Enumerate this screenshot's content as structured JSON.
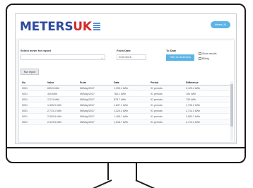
{
  "app": {
    "logo_part1": "METERS",
    "logo_part2": "UK",
    "header_button": "Meters UK"
  },
  "form": {
    "meter_label": "Select meter for report",
    "meter_value": "",
    "from_label": "From Date",
    "from_value": "01/01/2018",
    "to_label": "To Date",
    "to_value": "31/03/2018",
    "checkbox_1": "Show results",
    "checkbox_2": "Billing",
    "run_button": "Run report",
    "action_button": "Filter for all devices"
  },
  "table": {
    "headers": [
      "No.",
      "Value",
      "From",
      "Date",
      "Period",
      "Difference"
    ],
    "rows": [
      [
        "0001",
        "695.9 kWh",
        "06/May/2017",
        "1,393.1 kWh",
        "91 periods",
        "2,123.4 kWh"
      ],
      [
        "0001",
        "345 kWh",
        "06/May/2017",
        "765.1 kWh",
        "91 periods",
        "154 kWh"
      ],
      [
        "0001",
        "172.3 kWh",
        "06/May/2017",
        "678.7 kWh",
        "91 periods",
        "735 kWh"
      ],
      [
        "0001",
        "1,526.9 kWh",
        "06/May/2017",
        "1,837.1 kWh",
        "91 periods",
        "1,796.2 kWh"
      ],
      [
        "0001",
        "2,713.1 kWh",
        "06/May/2017",
        "1,224.2 kWh",
        "91 periods",
        "2,714.3 kWh"
      ],
      [
        "0001",
        "2,553.8 kWh",
        "06/May/2017",
        "1,165.1 kWh",
        "91 periods",
        "2,853.2 kWh"
      ],
      [
        "0001",
        "2,319.5 kWh",
        "06/May/2017",
        "1,516.7 kWh",
        "91 periods",
        "2,713.4 kWh"
      ]
    ]
  },
  "colors": {
    "brand_blue": "#2e4a9e",
    "brand_red": "#d22b2b",
    "accent": "#5ab4e6"
  }
}
